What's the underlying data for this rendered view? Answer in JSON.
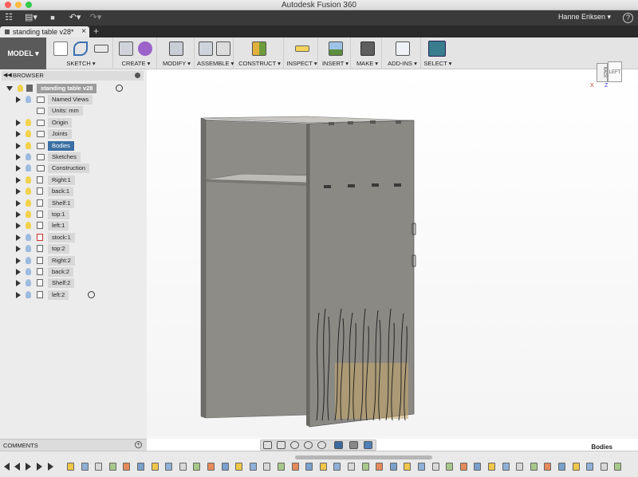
{
  "window": {
    "title": "Autodesk Fusion 360"
  },
  "user": {
    "name": "Hanne Eriksen ▾",
    "help": "?"
  },
  "quick_access": {
    "grid": "☷",
    "file": "▤▾",
    "save": "■",
    "undo": "↶▾",
    "redo": "↷▾"
  },
  "document_tab": {
    "name": "standing table v28*",
    "close": "×",
    "new_tab": "+"
  },
  "workspace": {
    "label": "MODEL ▾"
  },
  "toolbar": {
    "groups": [
      {
        "label": "SKETCH ▾",
        "icon": "sketch-icon"
      },
      {
        "label": "CREATE ▾",
        "icon": "extrude-icon"
      },
      {
        "label": "MODIFY ▾",
        "icon": "press-pull-icon"
      },
      {
        "label": "ASSEMBLE ▾",
        "icon": "joint-icon"
      },
      {
        "label": "CONSTRUCT ▾",
        "icon": "plane-icon"
      },
      {
        "label": "INSPECT ▾",
        "icon": "measure-icon"
      },
      {
        "label": "INSERT ▾",
        "icon": "image-icon"
      },
      {
        "label": "MAKE ▾",
        "icon": "printer-icon"
      },
      {
        "label": "ADD-INS ▾",
        "icon": "scripts-icon"
      },
      {
        "label": "SELECT ▾",
        "icon": "cursor-icon"
      }
    ]
  },
  "browser": {
    "title": "BROWSER",
    "root": "standing table v28",
    "items": [
      {
        "label": "Named Views",
        "type": "folder"
      },
      {
        "label": "Units: mm",
        "type": "units"
      },
      {
        "label": "Origin",
        "type": "folder"
      },
      {
        "label": "Joints",
        "type": "folder"
      },
      {
        "label": "Bodies",
        "type": "folder",
        "selected": true
      },
      {
        "label": "Sketches",
        "type": "folder"
      },
      {
        "label": "Construction",
        "type": "folder"
      },
      {
        "label": "Right:1",
        "type": "body"
      },
      {
        "label": "back:1",
        "type": "body"
      },
      {
        "label": "Shelf:1",
        "type": "body"
      },
      {
        "label": "top:1",
        "type": "body"
      },
      {
        "label": "left:1",
        "type": "body"
      },
      {
        "label": "stock:1",
        "type": "body"
      },
      {
        "label": "top:2",
        "type": "body"
      },
      {
        "label": "Right:2",
        "type": "body"
      },
      {
        "label": "back:2",
        "type": "body"
      },
      {
        "label": "Shelf:2",
        "type": "body"
      },
      {
        "label": "left:2",
        "type": "body"
      }
    ]
  },
  "viewcube": {
    "left_label": "LEFT",
    "back_label": "BACK",
    "x_axis": "X",
    "z_axis": "Z"
  },
  "comments": {
    "label": "COMMENTS",
    "add": "+"
  },
  "status": {
    "selection": "Bodies"
  },
  "colors": {
    "accent_selected": "#3b6fa4",
    "bulb_on": "#f2d24b",
    "bulb_off": "#9dbbe0",
    "panel": "#8c8a85"
  }
}
